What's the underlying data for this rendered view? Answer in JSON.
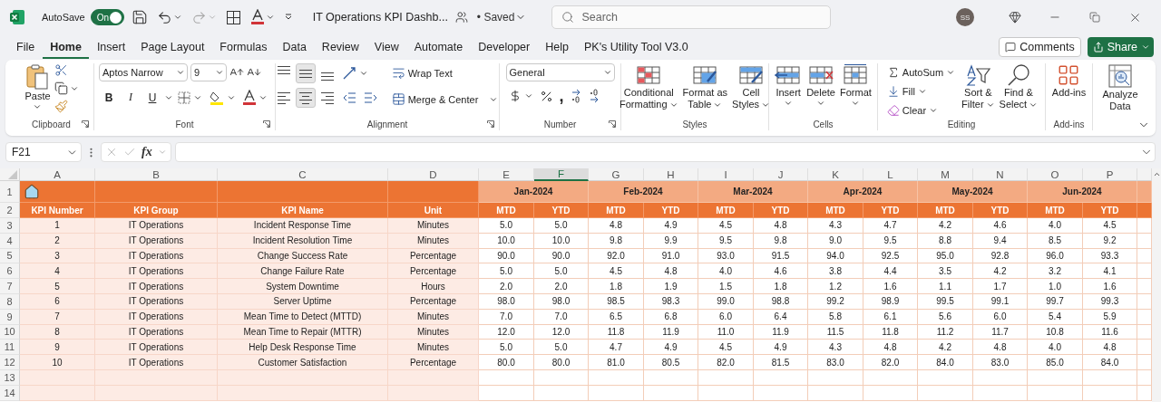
{
  "titlebar": {
    "autosave_label": "AutoSave",
    "autosave_on": true,
    "toggle_text": "On",
    "redo_disabled": true,
    "document_title": "IT Operations KPI Dashb...",
    "save_status": "• Saved",
    "search_placeholder": "Search",
    "user_initials": "SS"
  },
  "menu": [
    {
      "label": "File",
      "selected": false
    },
    {
      "label": "Home",
      "selected": true
    },
    {
      "label": "Insert",
      "selected": false
    },
    {
      "label": "Page Layout",
      "selected": false
    },
    {
      "label": "Formulas",
      "selected": false
    },
    {
      "label": "Data",
      "selected": false
    },
    {
      "label": "Review",
      "selected": false
    },
    {
      "label": "View",
      "selected": false
    },
    {
      "label": "Automate",
      "selected": false
    },
    {
      "label": "Developer",
      "selected": false
    },
    {
      "label": "Help",
      "selected": false
    },
    {
      "label": "PK's Utility Tool V3.0",
      "selected": false
    }
  ],
  "comments_button": "Comments",
  "share_button": "Share",
  "ribbon": {
    "clipboard": {
      "paste": "Paste",
      "label": "Clipboard"
    },
    "font": {
      "name": "Aptos Narrow",
      "size": "9",
      "bold": "B",
      "italic": "I",
      "underline": "U",
      "label": "Font"
    },
    "alignment": {
      "vertical": [
        {
          "selected": false
        },
        {
          "selected": true
        },
        {
          "selected": false
        }
      ],
      "horizontal": [
        {
          "selected": false
        },
        {
          "selected": true
        },
        {
          "selected": false
        }
      ],
      "wrap_text": "Wrap Text",
      "merge": "Merge & Center",
      "label": "Alignment"
    },
    "number": {
      "format": "General",
      "comma": ",",
      "label": "Number"
    },
    "styles": {
      "label": "Styles",
      "buttons": [
        [
          "Conditional",
          "Formatting"
        ],
        [
          "Format as",
          "Table"
        ],
        [
          "Cell",
          "Styles"
        ]
      ]
    },
    "cells": {
      "label": "Cells",
      "buttons": [
        "Insert",
        "Delete",
        "Format"
      ]
    },
    "editing": {
      "label": "Editing",
      "autosum": "AutoSum",
      "fill": "Fill",
      "clear": "Clear",
      "sort": [
        "Sort &",
        "Filter"
      ],
      "find": [
        "Find &",
        "Select"
      ]
    },
    "addins": {
      "label": "Add-ins",
      "button": "Add-ins"
    },
    "analysis": {
      "button": [
        "Analyze",
        "Data"
      ]
    }
  },
  "formula_bar": {
    "name_box": "F21",
    "function_label": "fx"
  },
  "sheet": {
    "columns": [
      {
        "letter": "A",
        "selected": false
      },
      {
        "letter": "B",
        "selected": false
      },
      {
        "letter": "C",
        "selected": false
      },
      {
        "letter": "D",
        "selected": false
      },
      {
        "letter": "E",
        "selected": false
      },
      {
        "letter": "F",
        "selected": true
      },
      {
        "letter": "G",
        "selected": false
      },
      {
        "letter": "H",
        "selected": false
      },
      {
        "letter": "I",
        "selected": false
      },
      {
        "letter": "J",
        "selected": false
      },
      {
        "letter": "K",
        "selected": false
      },
      {
        "letter": "L",
        "selected": false
      },
      {
        "letter": "M",
        "selected": false
      },
      {
        "letter": "N",
        "selected": false
      },
      {
        "letter": "O",
        "selected": false
      },
      {
        "letter": "P",
        "selected": false
      }
    ],
    "row_numbers": [
      "1",
      "2",
      "3",
      "4",
      "5",
      "6",
      "7",
      "8",
      "9",
      "10",
      "11",
      "12",
      "13",
      "14"
    ],
    "months": [
      "Jan-2024",
      "Feb-2024",
      "Mar-2024",
      "Apr-2024",
      "May-2024",
      "Jun-2024"
    ],
    "headers": [
      "KPI Number",
      "KPI Group",
      "KPI Name",
      "Unit"
    ],
    "sub_headers": [
      "MTD",
      "YTD",
      "MTD",
      "YTD",
      "MTD",
      "YTD",
      "MTD",
      "YTD",
      "MTD",
      "YTD",
      "MTD",
      "YTD"
    ],
    "rows": [
      {
        "number": "1",
        "group": "IT Operations",
        "name": "Incident Response Time",
        "unit": "Minutes",
        "values": [
          "5.0",
          "5.0",
          "4.8",
          "4.9",
          "4.5",
          "4.8",
          "4.3",
          "4.7",
          "4.2",
          "4.6",
          "4.0",
          "4.5"
        ]
      },
      {
        "number": "2",
        "group": "IT Operations",
        "name": "Incident Resolution Time",
        "unit": "Minutes",
        "values": [
          "10.0",
          "10.0",
          "9.8",
          "9.9",
          "9.5",
          "9.8",
          "9.0",
          "9.5",
          "8.8",
          "9.4",
          "8.5",
          "9.2"
        ]
      },
      {
        "number": "3",
        "group": "IT Operations",
        "name": "Change Success Rate",
        "unit": "Percentage",
        "values": [
          "90.0",
          "90.0",
          "92.0",
          "91.0",
          "93.0",
          "91.5",
          "94.0",
          "92.5",
          "95.0",
          "92.8",
          "96.0",
          "93.3"
        ]
      },
      {
        "number": "4",
        "group": "IT Operations",
        "name": "Change Failure Rate",
        "unit": "Percentage",
        "values": [
          "5.0",
          "5.0",
          "4.5",
          "4.8",
          "4.0",
          "4.6",
          "3.8",
          "4.4",
          "3.5",
          "4.2",
          "3.2",
          "4.1"
        ]
      },
      {
        "number": "5",
        "group": "IT Operations",
        "name": "System Downtime",
        "unit": "Hours",
        "values": [
          "2.0",
          "2.0",
          "1.8",
          "1.9",
          "1.5",
          "1.8",
          "1.2",
          "1.6",
          "1.1",
          "1.7",
          "1.0",
          "1.6"
        ]
      },
      {
        "number": "6",
        "group": "IT Operations",
        "name": "Server Uptime",
        "unit": "Percentage",
        "values": [
          "98.0",
          "98.0",
          "98.5",
          "98.3",
          "99.0",
          "98.8",
          "99.2",
          "98.9",
          "99.5",
          "99.1",
          "99.7",
          "99.3"
        ]
      },
      {
        "number": "7",
        "group": "IT Operations",
        "name": "Mean Time to Detect (MTTD)",
        "unit": "Minutes",
        "values": [
          "7.0",
          "7.0",
          "6.5",
          "6.8",
          "6.0",
          "6.4",
          "5.8",
          "6.1",
          "5.6",
          "6.0",
          "5.4",
          "5.9"
        ]
      },
      {
        "number": "8",
        "group": "IT Operations",
        "name": "Mean Time to Repair (MTTR)",
        "unit": "Minutes",
        "values": [
          "12.0",
          "12.0",
          "11.8",
          "11.9",
          "11.0",
          "11.9",
          "11.5",
          "11.8",
          "11.2",
          "11.7",
          "10.8",
          "11.6"
        ]
      },
      {
        "number": "9",
        "group": "IT Operations",
        "name": "Help Desk Response Time",
        "unit": "Minutes",
        "values": [
          "5.0",
          "5.0",
          "4.7",
          "4.9",
          "4.5",
          "4.9",
          "4.3",
          "4.8",
          "4.2",
          "4.8",
          "4.0",
          "4.8"
        ]
      },
      {
        "number": "10",
        "group": "IT Operations",
        "name": "Customer Satisfaction",
        "unit": "Percentage",
        "values": [
          "80.0",
          "80.0",
          "81.0",
          "80.5",
          "82.0",
          "81.5",
          "83.0",
          "82.0",
          "84.0",
          "83.0",
          "85.0",
          "84.0"
        ]
      }
    ]
  }
}
